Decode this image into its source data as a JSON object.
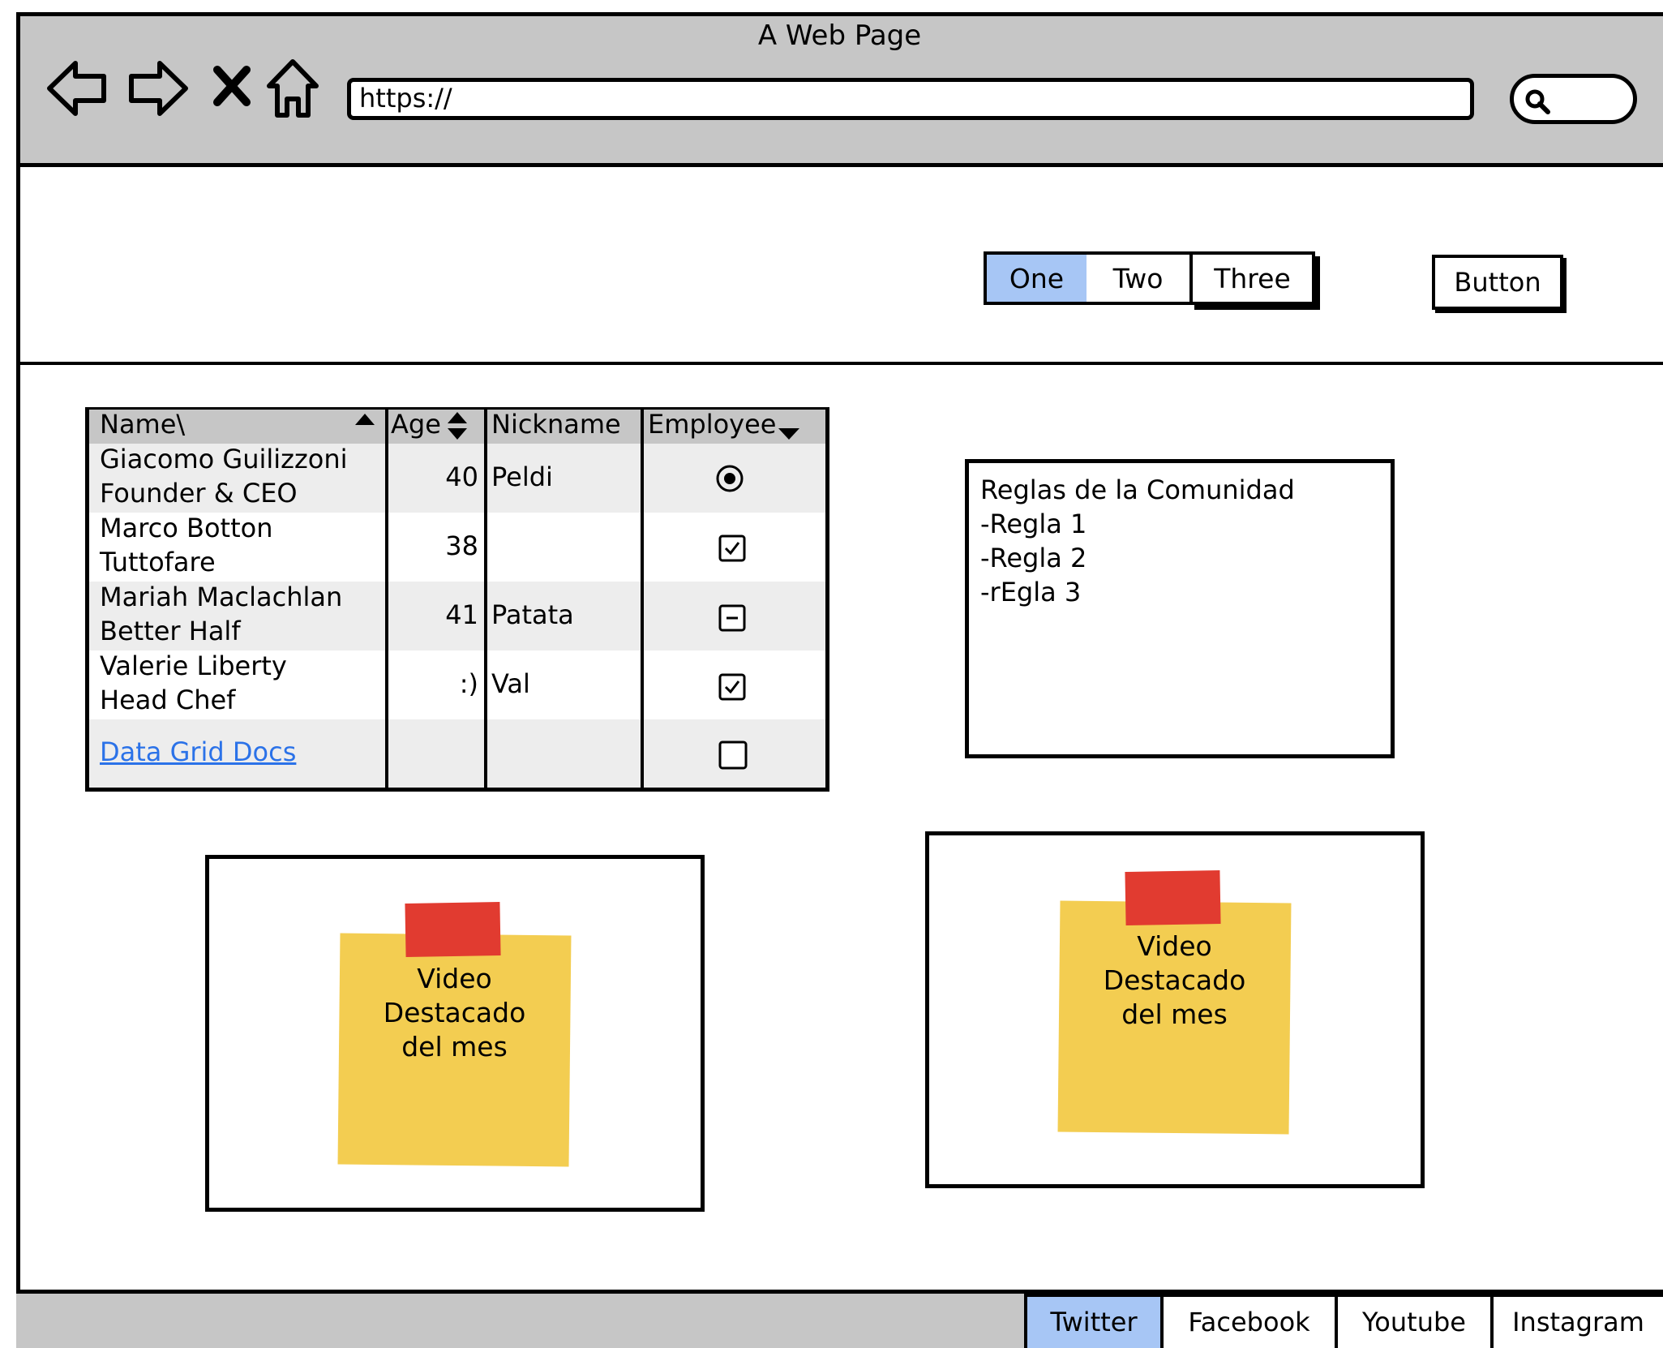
{
  "browser": {
    "title": "A Web Page",
    "url": "https://"
  },
  "tabs": [
    "One",
    "Two",
    "Three"
  ],
  "button_label": "Button",
  "grid": {
    "headers": [
      "Name\\",
      "Age",
      "Nickname",
      "Employee"
    ],
    "rows": [
      {
        "name": "Giacomo Guilizzoni",
        "role": "Founder & CEO",
        "age": "40",
        "nickname": "Peldi",
        "employee": "radio-selected"
      },
      {
        "name": "Marco Botton",
        "role": "Tuttofare",
        "age": "38",
        "nickname": "",
        "employee": "checked"
      },
      {
        "name": "Mariah Maclachlan",
        "role": "Better Half",
        "age": "41",
        "nickname": "Patata",
        "employee": "indeterminate"
      },
      {
        "name": "Valerie Liberty",
        "role": "Head Chef",
        "age": ":)",
        "nickname": "Val",
        "employee": "checked"
      }
    ],
    "link": "Data Grid Docs",
    "last_row_employee": "unchecked"
  },
  "rules": {
    "title": "Reglas de la Comunidad",
    "items": [
      "-Regla 1",
      "-Regla 2",
      "-rEgla 3"
    ]
  },
  "video_cards": [
    {
      "line1": "Video",
      "line2": "Destacado",
      "line3": "del mes"
    },
    {
      "line1": "Video",
      "line2": "Destacado",
      "line3": "del mes"
    }
  ],
  "footer_tabs": [
    "Twitter",
    "Facebook",
    "Youtube",
    "Instagram"
  ],
  "colors": {
    "selected_tab": "#a7c6f5",
    "chrome": "#c6c6c6",
    "sticky_note": "#f3cd51",
    "tape": "#e13b30",
    "link": "#2b72e8"
  }
}
